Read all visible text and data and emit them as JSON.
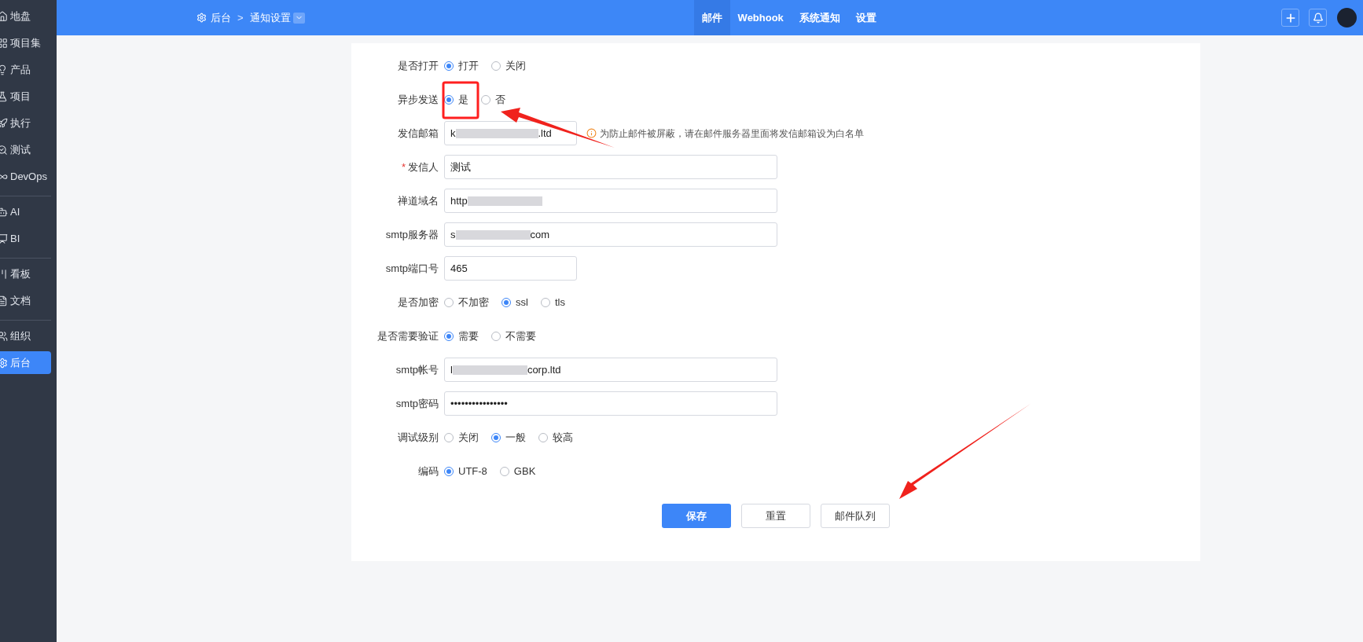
{
  "sidebar": {
    "groups": [
      {
        "items": [
          {
            "label": "地盘",
            "selected": false
          },
          {
            "label": "项目集",
            "selected": false
          },
          {
            "label": "产品",
            "selected": false
          },
          {
            "label": "项目",
            "selected": false
          },
          {
            "label": "执行",
            "selected": false
          },
          {
            "label": "测试",
            "selected": false
          },
          {
            "label": "DevOps",
            "selected": false
          }
        ]
      },
      {
        "items": [
          {
            "label": "AI",
            "selected": false
          },
          {
            "label": "BI",
            "selected": false
          }
        ]
      },
      {
        "items": [
          {
            "label": "看板",
            "selected": false
          },
          {
            "label": "文档",
            "selected": false
          }
        ]
      },
      {
        "items": [
          {
            "label": "组织",
            "selected": false
          },
          {
            "label": "后台",
            "selected": true
          }
        ]
      }
    ]
  },
  "topbar": {
    "breadcrumb": [
      "后台",
      "通知设置"
    ],
    "separator": ">",
    "tabs": [
      {
        "label": "邮件",
        "selected": true
      },
      {
        "label": "Webhook",
        "selected": false
      },
      {
        "label": "系统通知",
        "selected": false
      },
      {
        "label": "设置",
        "selected": false
      }
    ]
  },
  "form": {
    "rows": [
      {
        "kind": "radio",
        "label": "是否打开",
        "options": [
          {
            "label": "打开",
            "selected": true
          },
          {
            "label": "关闭",
            "selected": false
          }
        ]
      },
      {
        "kind": "radio",
        "label": "异步发送",
        "options": [
          {
            "label": "是",
            "selected": true
          },
          {
            "label": "否",
            "selected": false
          }
        ]
      },
      {
        "kind": "short-field",
        "label": "发信邮箱",
        "value": "k",
        "value_end": ".ltd",
        "redacted": true,
        "hint": "为防止邮件被屏蔽，请在邮件服务器里面将发信邮箱设为白名单"
      },
      {
        "kind": "field",
        "label": "发信人",
        "required_mark": "*",
        "value": "测试"
      },
      {
        "kind": "field",
        "label": "禅道域名",
        "value": "http",
        "redacted": true
      },
      {
        "kind": "field",
        "label": "smtp服务器",
        "value": "s",
        "value_end": "com",
        "redacted": true
      },
      {
        "kind": "short-field",
        "label": "smtp端口号",
        "value": "465"
      },
      {
        "kind": "radio",
        "label": "是否加密",
        "options": [
          {
            "label": "不加密",
            "selected": false
          },
          {
            "label": "ssl",
            "selected": true
          },
          {
            "label": "tls",
            "selected": false
          }
        ]
      },
      {
        "kind": "radio",
        "label": "是否需要验证",
        "options": [
          {
            "label": "需要",
            "selected": true
          },
          {
            "label": "不需要",
            "selected": false
          }
        ]
      },
      {
        "kind": "field",
        "label": "smtp帐号",
        "value": "l",
        "value_end": "corp.ltd",
        "redacted": true
      },
      {
        "kind": "field",
        "label": "smtp密码",
        "value": "••••••••••••••••"
      },
      {
        "kind": "radio",
        "label": "调试级别",
        "options": [
          {
            "label": "关闭",
            "selected": false
          },
          {
            "label": "一般",
            "selected": true
          },
          {
            "label": "较高",
            "selected": false
          }
        ]
      },
      {
        "kind": "radio",
        "label": "编码",
        "options": [
          {
            "label": "UTF-8",
            "selected": true
          },
          {
            "label": "GBK",
            "selected": false
          }
        ]
      }
    ],
    "buttons": [
      {
        "label": "保存",
        "kind": "primary"
      },
      {
        "label": "重置",
        "kind": "default"
      },
      {
        "label": "邮件队列",
        "kind": "default"
      }
    ]
  }
}
